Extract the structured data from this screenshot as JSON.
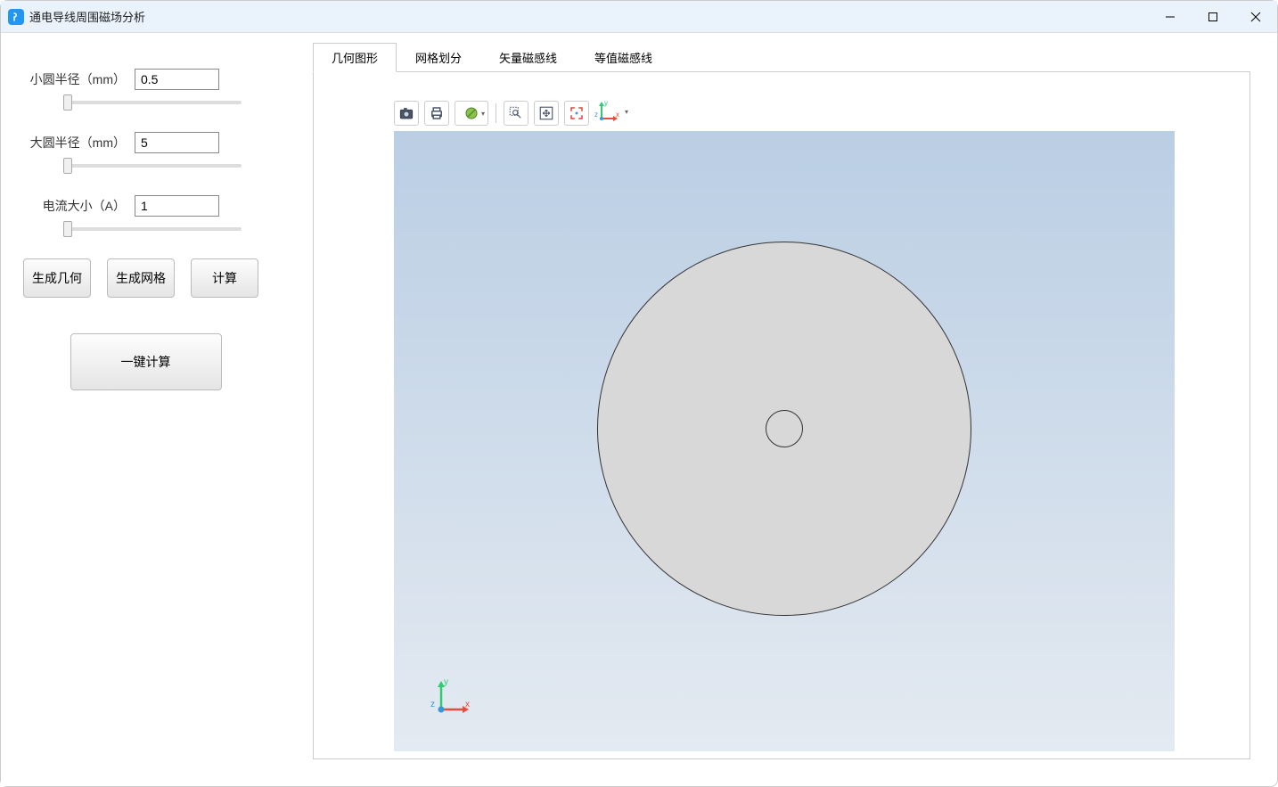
{
  "window": {
    "title": "通电导线周围磁场分析"
  },
  "params": {
    "small_radius": {
      "label": "小圆半径（mm）",
      "value": "0.5"
    },
    "large_radius": {
      "label": "大圆半径（mm）",
      "value": "5"
    },
    "current": {
      "label": "电流大小（A）",
      "value": "1"
    }
  },
  "buttons": {
    "generate_geometry": "生成几何",
    "generate_mesh": "生成网格",
    "calculate": "计算",
    "one_click": "一键计算"
  },
  "tabs": {
    "geometry": "几何图形",
    "mesh": "网格划分",
    "vector": "矢量磁感线",
    "contour": "等值磁感线"
  },
  "axes": {
    "x": "x",
    "y": "y",
    "z": "z"
  }
}
